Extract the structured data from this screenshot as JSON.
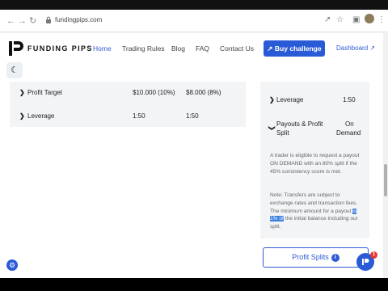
{
  "browser": {
    "url": "fundingpips.com",
    "icons": [
      "back-icon",
      "forward-icon",
      "reload-icon",
      "share-icon",
      "star-icon",
      "extensions-icon",
      "sidebar-icon",
      "profile-avatar",
      "more-icon"
    ]
  },
  "header": {
    "logo_text": "FUNDING PIPS",
    "nav": [
      "Home",
      "Trading Rules",
      "Blog",
      "FAQ",
      "Contact Us"
    ],
    "active_nav": "Home",
    "cta_label": "Buy challenge",
    "dashboard_label": "Dashboard"
  },
  "rules_table": {
    "rows": [
      {
        "label": "Profit Target",
        "col1": "$10.000 (10%)",
        "col2": "$8.000 (8%)"
      },
      {
        "label": "Leverage",
        "col1": "1:50",
        "col2": "1:50"
      }
    ]
  },
  "sidebar_card": {
    "leverage_label": "Leverage",
    "leverage_value": "1:50",
    "payouts_label_1": "Payouts & Profit",
    "payouts_label_2": "Split",
    "payouts_value_1": "On",
    "payouts_value_2": "Demand",
    "paragraph1": "A trader is eligible to request a payout ON DEMAND with an 80% split if the 45% consistency score is met.",
    "p2_before": "Note: Transfers are subject to exchange rates and transaction fees. The minimum amount for a payout ",
    "p2_highlight": "is 1% of",
    "p2_after": " the initial balance including our split."
  },
  "profit_splits_label": "Profit Splits",
  "chat_badge_count": "1",
  "colors": {
    "accent": "#2a5bd7",
    "highlight": "#3d7ee0",
    "badge": "#e53935"
  }
}
